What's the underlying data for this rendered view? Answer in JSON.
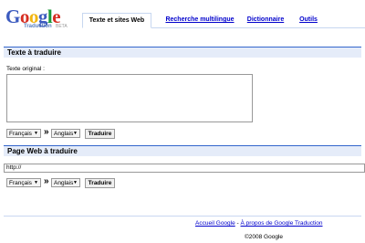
{
  "logo": {
    "word": "Google",
    "sub": "Traduction",
    "beta": "BETA"
  },
  "tabs": [
    {
      "label": "Texte et sites Web",
      "active": true
    },
    {
      "label": "Recherche multilingue",
      "active": false
    },
    {
      "label": "Dictionnaire",
      "active": false
    },
    {
      "label": "Outils",
      "active": false
    }
  ],
  "text_section": {
    "title": "Texte à traduire",
    "original_label": "Texte original :",
    "source_lang": "Français",
    "target_lang": "Anglais",
    "arrow": "»",
    "translate_label": "Traduire"
  },
  "web_section": {
    "title": "Page Web à traduire",
    "url_value": "http://",
    "source_lang": "Français",
    "target_lang": "Anglais",
    "arrow": "»",
    "translate_label": "Traduire"
  },
  "footer": {
    "link_home": "Accueil Google",
    "separator": " - ",
    "link_about": "À propos de Google Traduction",
    "copyright": "©2008 Google"
  },
  "colors": {
    "link": "#0000cc",
    "section_bg": "#e5ecf9",
    "section_border": "#3366cc"
  }
}
